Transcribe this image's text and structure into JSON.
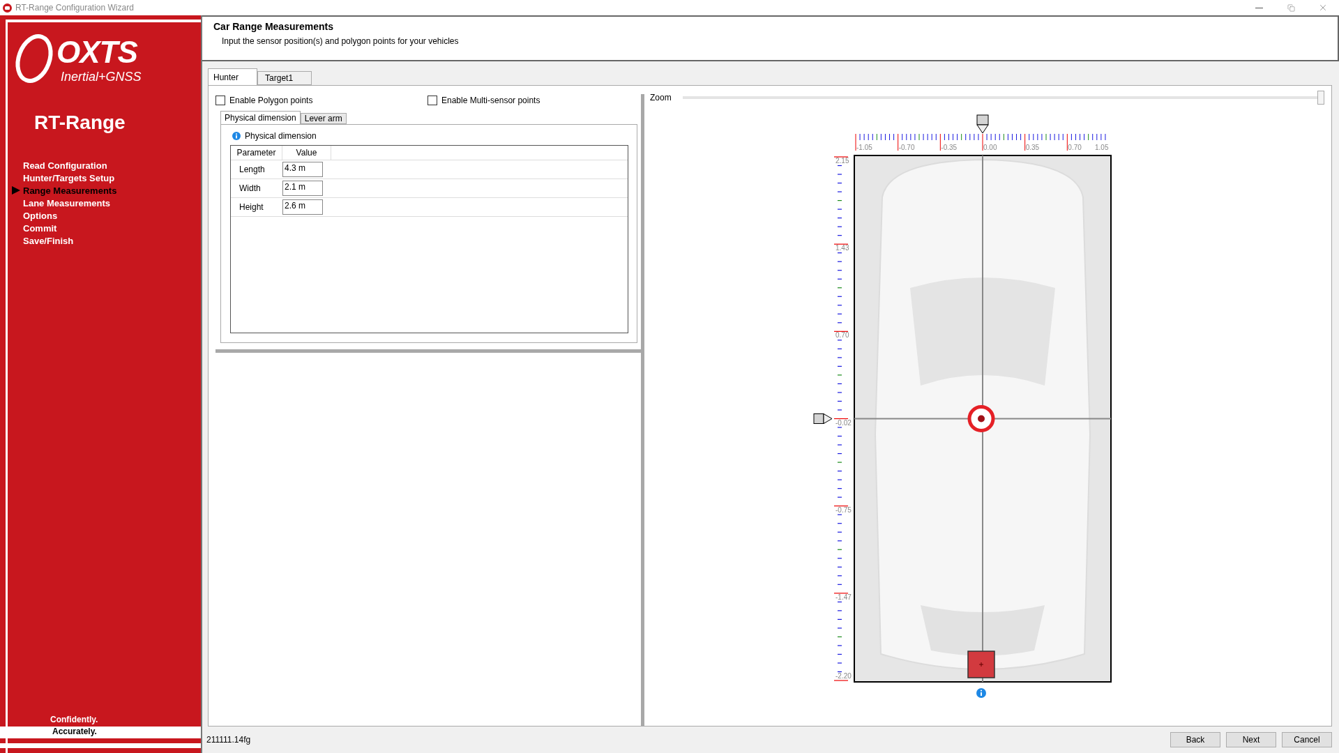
{
  "window": {
    "title": "RT-Range Configuration Wizard"
  },
  "sidebar": {
    "logo_text": "OXTS",
    "logo_subtext": "Inertial+GNSS",
    "product": "RT-Range",
    "items": [
      {
        "label": "Read Configuration",
        "selected": false
      },
      {
        "label": "Hunter/Targets Setup",
        "selected": false
      },
      {
        "label": "Range Measurements",
        "selected": true
      },
      {
        "label": "Lane Measurements",
        "selected": false
      },
      {
        "label": "Options",
        "selected": false
      },
      {
        "label": "Commit",
        "selected": false
      },
      {
        "label": "Save/Finish",
        "selected": false
      }
    ],
    "tagline": [
      "Confidently.",
      "Accurately."
    ]
  },
  "header": {
    "title": "Car Range Measurements",
    "subtitle": "Input the sensor position(s) and polygon points for your vehicles"
  },
  "vehicle_tabs": [
    {
      "label": "Hunter",
      "selected": true
    },
    {
      "label": "Target1",
      "selected": false
    }
  ],
  "options": [
    {
      "label": "Enable Polygon points",
      "checked": false
    },
    {
      "label": "Enable Multi-sensor points",
      "checked": false
    }
  ],
  "detail_tabs": [
    {
      "label": "Physical dimension",
      "selected": true
    },
    {
      "label": "Lever arm",
      "selected": false
    }
  ],
  "group": {
    "title": "Physical dimension",
    "columns": [
      "Parameter",
      "Value"
    ],
    "rows": [
      {
        "parameter": "Length",
        "value": "4.3 m"
      },
      {
        "parameter": "Width",
        "value": "2.1 m"
      },
      {
        "parameter": "Height",
        "value": "2.6 m"
      }
    ]
  },
  "zoom": {
    "label": "Zoom",
    "level": 1
  },
  "ruler_x": {
    "labels": [
      "-1.05",
      "-0.70",
      "-0.35",
      "0.00",
      "0.35",
      "0.70",
      "1.05"
    ]
  },
  "ruler_y": {
    "labels": [
      "2.15",
      "1.43",
      "0.70",
      "-0.02",
      "-0.75",
      "-1.47",
      "-2.20"
    ]
  },
  "status": "211111.14fg",
  "buttons": [
    {
      "label": "Back"
    },
    {
      "label": "Next"
    },
    {
      "label": "Cancel"
    }
  ]
}
